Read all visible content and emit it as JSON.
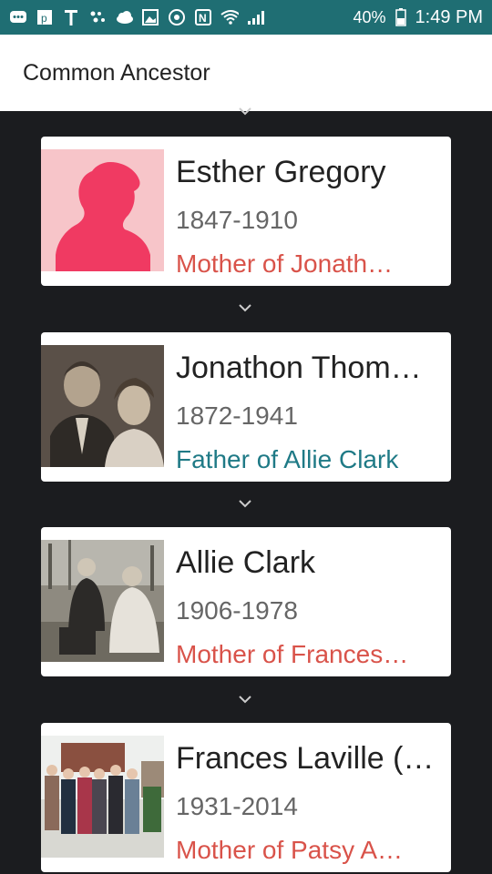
{
  "status_bar": {
    "battery": "40%",
    "time": "1:49 PM",
    "icons": [
      "messenger-icon",
      "photo-app-icon",
      "t-mobile-icon",
      "dots-icon",
      "cloud-icon",
      "image-icon",
      "sync-icon",
      "nfc-icon",
      "wifi-icon",
      "signal-icon",
      "battery-icon"
    ]
  },
  "header": {
    "title": "Common Ancestor"
  },
  "colors": {
    "status_bar": "#1f6e73",
    "background": "#1b1c1f",
    "relation_mother": "#d9534a",
    "relation_father": "#1f7a86"
  },
  "cards": [
    {
      "name": "Esther Gregory",
      "years": "1847-1910",
      "relation": "Mother of Jonath…",
      "relation_type": "mother",
      "photo": "female-silhouette-placeholder"
    },
    {
      "name": "Jonathon Thom…",
      "years": "1872-1941",
      "relation": "Father of Allie Clark",
      "relation_type": "father",
      "photo": "sepia-couple-portrait"
    },
    {
      "name": "Allie Clark",
      "years": "1906-1978",
      "relation": "Mother of Frances…",
      "relation_type": "mother",
      "photo": "couple-seated-outdoors"
    },
    {
      "name": "Frances Laville (…",
      "years": "1931-2014",
      "relation": "Mother of Patsy A…",
      "relation_type": "mother",
      "photo": "family-group-photo"
    }
  ]
}
